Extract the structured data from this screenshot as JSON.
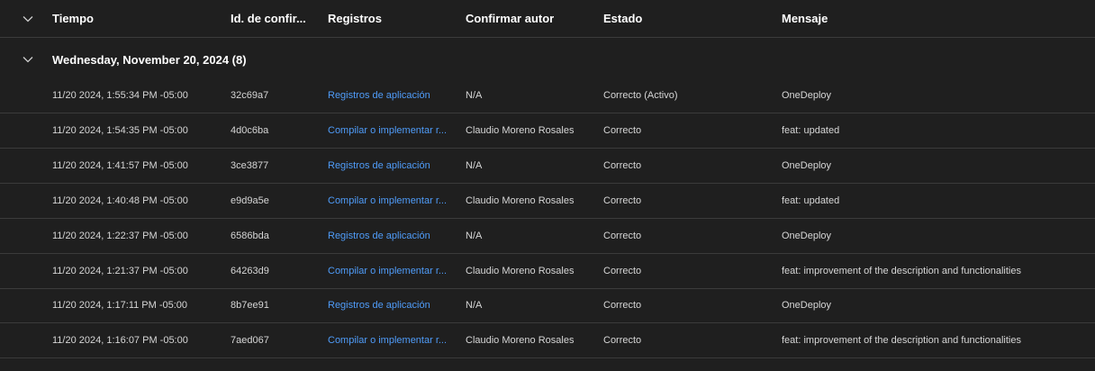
{
  "header": {
    "columns": [
      "Tiempo",
      "Id. de confir...",
      "Registros",
      "Confirmar autor",
      "Estado",
      "Mensaje"
    ]
  },
  "group": {
    "label": "Wednesday, November 20, 2024 (8)"
  },
  "rows": [
    {
      "time": "11/20 2024, 1:55:34 PM -05:00",
      "id": "32c69a7",
      "logs": "Registros de aplicación",
      "author": "N/A",
      "state": "Correcto (Activo)",
      "message": "OneDeploy"
    },
    {
      "time": "11/20 2024, 1:54:35 PM -05:00",
      "id": "4d0c6ba",
      "logs": "Compilar o implementar r...",
      "author": "Claudio Moreno Rosales",
      "state": "Correcto",
      "message": "feat: updated"
    },
    {
      "time": "11/20 2024, 1:41:57 PM -05:00",
      "id": "3ce3877",
      "logs": "Registros de aplicación",
      "author": "N/A",
      "state": "Correcto",
      "message": "OneDeploy"
    },
    {
      "time": "11/20 2024, 1:40:48 PM -05:00",
      "id": "e9d9a5e",
      "logs": "Compilar o implementar r...",
      "author": "Claudio Moreno Rosales",
      "state": "Correcto",
      "message": "feat: updated"
    },
    {
      "time": "11/20 2024, 1:22:37 PM -05:00",
      "id": "6586bda",
      "logs": "Registros de aplicación",
      "author": "N/A",
      "state": "Correcto",
      "message": "OneDeploy"
    },
    {
      "time": "11/20 2024, 1:21:37 PM -05:00",
      "id": "64263d9",
      "logs": "Compilar o implementar r...",
      "author": "Claudio Moreno Rosales",
      "state": "Correcto",
      "message": "feat: improvement of the description and functionalities"
    },
    {
      "time": "11/20 2024, 1:17:11 PM -05:00",
      "id": "8b7ee91",
      "logs": "Registros de aplicación",
      "author": "N/A",
      "state": "Correcto",
      "message": "OneDeploy"
    },
    {
      "time": "11/20 2024, 1:16:07 PM -05:00",
      "id": "7aed067",
      "logs": "Compilar o implementar r...",
      "author": "Claudio Moreno Rosales",
      "state": "Correcto",
      "message": "feat: improvement of the description and functionalities"
    }
  ],
  "colors": {
    "background": "#1f1f1f",
    "link": "#4f9cf9",
    "divider": "#3b3b3b"
  },
  "icons": {
    "header_toggle": "chevron-down-icon",
    "group_toggle": "chevron-down-icon"
  }
}
